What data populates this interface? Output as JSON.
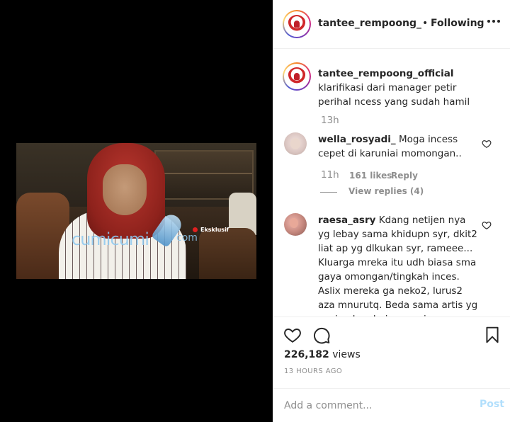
{
  "post": {
    "username": "tantee_rempoong_offic",
    "separator": "•",
    "follow_status": "Following"
  },
  "video": {
    "watermark": "cumicumi",
    "watermark_tail": "com",
    "live_label": "Eksklusif"
  },
  "caption": {
    "username": "tantee_rempoong_official",
    "text": " klarifikasi dari manager petir perihal ncess yang sudah hamil",
    "time": "13h"
  },
  "comments": [
    {
      "username": "wella_rosyadi_",
      "text": " Moga incess cepet di karuniai momongan..",
      "time": "11h",
      "likes": "161 likes",
      "reply_label": "Reply",
      "view_replies": "View replies (4)"
    },
    {
      "username": "raesa_asry",
      "text": " Kdang netijen nya yg lebay sama khidupn syr, dkit2 liat ap yg dlkukan syr, rameee... Kluarga mreka itu udh biasa sma gaya omongan/tingkah inces. Aslix mereka ga neko2, lurus2 aza mnurutq. Beda sama artis yg sngja alay dmi sensasi"
    }
  ],
  "stats": {
    "views_count": "226,182",
    "views_label": "views",
    "time_ago": "13 HOURS AGO"
  },
  "comment_box": {
    "placeholder": "Add a comment...",
    "post_label": "Post"
  },
  "icons": {
    "more": "more-options-icon",
    "heart": "heart-icon",
    "comment": "comment-icon",
    "bookmark": "bookmark-icon"
  },
  "colors": {
    "accent_disabled": "#b2dffc",
    "secondary_text": "#8e8e8e",
    "primary_text": "#262626"
  }
}
